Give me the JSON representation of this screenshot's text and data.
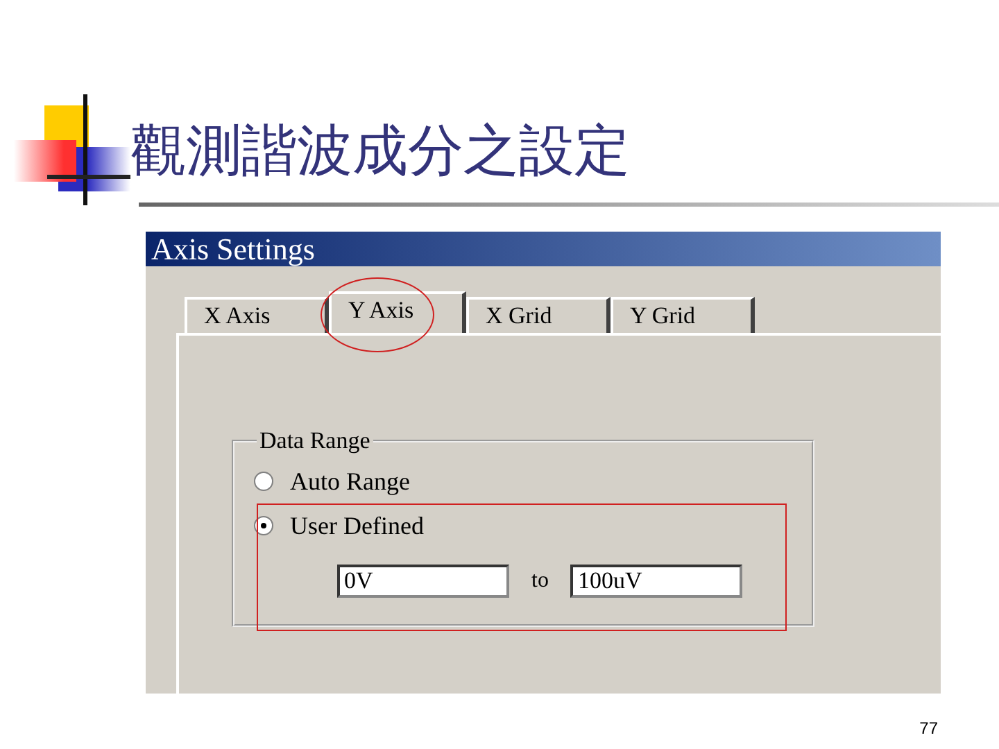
{
  "slide": {
    "title": "觀測諧波成分之設定",
    "page_number": "77"
  },
  "window": {
    "title": "Axis Settings"
  },
  "tabs": [
    {
      "label": "X Axis",
      "selected": false
    },
    {
      "label": "Y Axis",
      "selected": true
    },
    {
      "label": "X Grid",
      "selected": false
    },
    {
      "label": "Y Grid",
      "selected": false
    }
  ],
  "data_range": {
    "title": "Data Range",
    "options": [
      {
        "label": "Auto Range",
        "selected": false
      },
      {
        "label": "User Defined",
        "selected": true
      }
    ],
    "from": {
      "value": "0V"
    },
    "separator": "to",
    "to": {
      "value": "100uV"
    }
  }
}
